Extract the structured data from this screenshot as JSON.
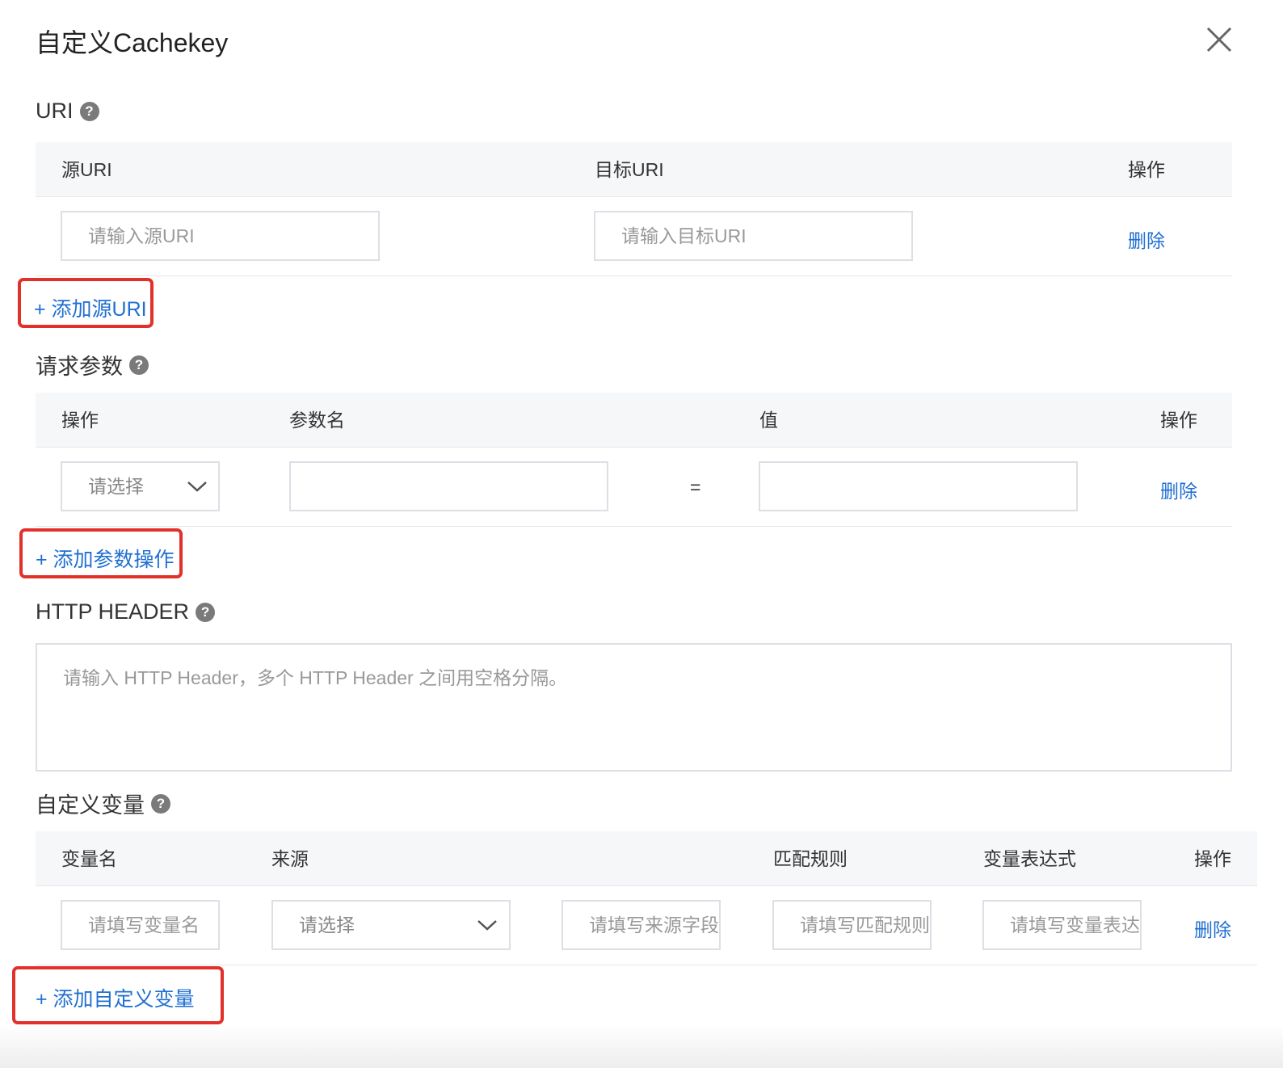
{
  "dialog": {
    "title": "自定义Cachekey"
  },
  "uri_section": {
    "label": "URI",
    "help": "?",
    "columns": [
      "源URI",
      "目标URI",
      "操作"
    ],
    "row": {
      "source_placeholder": "请输入源URI",
      "target_placeholder": "请输入目标URI",
      "delete_label": "删除"
    },
    "add_label": "+ 添加源URI"
  },
  "params_section": {
    "label": "请求参数",
    "help": "?",
    "columns": [
      "操作",
      "参数名",
      "值",
      "操作"
    ],
    "row": {
      "action_select": "请选择",
      "param_name_value": "",
      "equals": "=",
      "param_value": "",
      "delete_label": "删除"
    },
    "add_label": "+ 添加参数操作"
  },
  "header_section": {
    "label": "HTTP HEADER",
    "help": "?",
    "textarea_placeholder": "请输入 HTTP Header，多个 HTTP Header 之间用空格分隔。"
  },
  "vars_section": {
    "label": "自定义变量",
    "help": "?",
    "columns": [
      "变量名",
      "来源",
      "匹配规则",
      "变量表达式",
      "操作"
    ],
    "row": {
      "var_name_placeholder": "请填写变量名",
      "source_select": "请选择",
      "source_field_placeholder": "请填写来源字段",
      "match_rule_placeholder": "请填写匹配规则",
      "expression_placeholder": "请填写变量表达式",
      "delete_label": "删除"
    },
    "add_label": "+ 添加自定义变量"
  },
  "colors": {
    "link": "#1f6fd1",
    "highlight_border": "#e2312a",
    "table_header_bg": "#f6f7f9"
  },
  "icons": {
    "close": "close-icon",
    "help": "help-icon",
    "dropdown": "chevron-down-icon"
  }
}
